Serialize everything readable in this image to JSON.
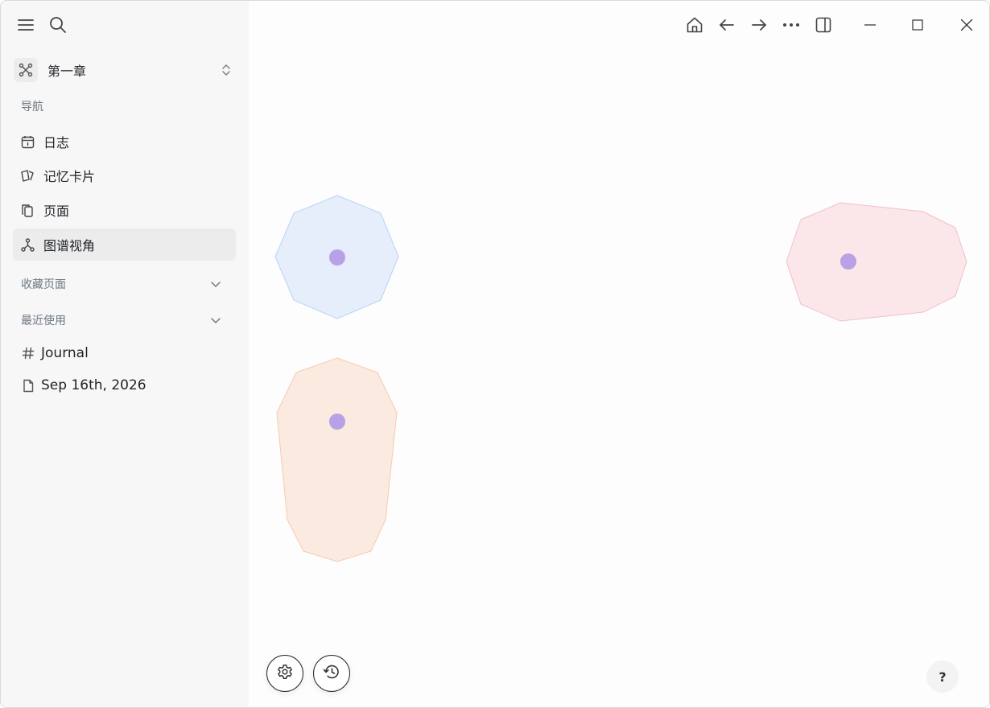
{
  "sidebar": {
    "graph": {
      "name": "第一章"
    },
    "nav_section_label": "导航",
    "nav_items": [
      {
        "label": "日志",
        "icon": "calendar-icon"
      },
      {
        "label": "记忆卡片",
        "icon": "cards-icon"
      },
      {
        "label": "页面",
        "icon": "pages-icon"
      },
      {
        "label": "图谱视角",
        "icon": "graph-icon",
        "active": true
      }
    ],
    "favorites_label": "收藏页面",
    "recent_label": "最近使用",
    "recent_items": [
      {
        "label": "Journal",
        "icon": "hash-icon"
      },
      {
        "label": "Sep 16th, 2026",
        "icon": "page-icon"
      }
    ]
  },
  "help_label": "?",
  "colors": {
    "node": "#b8a1e6",
    "cluster_blue_fill": "#e6eefb",
    "cluster_blue_stroke": "#b9d2f5",
    "cluster_pink_fill": "#fbe6ea",
    "cluster_pink_stroke": "#f3bfcb",
    "cluster_orange_fill": "#fbeadf",
    "cluster_orange_stroke": "#f5cbb0"
  }
}
